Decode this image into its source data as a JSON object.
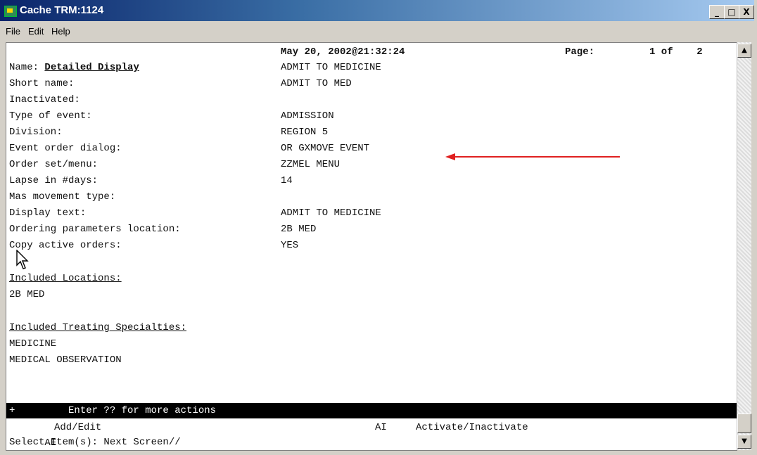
{
  "window": {
    "title": "Cache TRM:1124",
    "minimize": "_",
    "maximize": "□",
    "close": "X"
  },
  "menu": [
    "File",
    "Edit",
    "Help"
  ],
  "header": {
    "left": "Detailed Display",
    "middle": "May 20, 2002@21:32:24",
    "page_label": "Page:",
    "page": "1 of    2"
  },
  "fields": [
    {
      "label": "Name:",
      "value": "ADMIT TO MEDICINE"
    },
    {
      "label": "Short name:",
      "value": "ADMIT TO MED"
    },
    {
      "label": "Inactivated:",
      "value": ""
    },
    {
      "label": "Type of event:",
      "value": "ADMISSION"
    },
    {
      "label": "Division:",
      "value": "REGION 5"
    },
    {
      "label": "Event order dialog:",
      "value": "OR GXMOVE EVENT"
    },
    {
      "label": "Order set/menu:",
      "value": "ZZMEL MENU"
    },
    {
      "label": "Lapse in #days:",
      "value": "14"
    },
    {
      "label": "Mas movement type:",
      "value": ""
    },
    {
      "label": "Display text:",
      "value": "ADMIT TO MEDICINE"
    },
    {
      "label": "Ordering parameters location:",
      "value": "2B MED"
    },
    {
      "label": "Copy active orders:",
      "value": "YES"
    }
  ],
  "sections": {
    "locations": {
      "title": "Included Locations:",
      "items": [
        "2B MED"
      ]
    },
    "specialties": {
      "title": "Included Treating Specialties:",
      "items": [
        "MEDICINE",
        "MEDICAL OBSERVATION"
      ]
    }
  },
  "actionbar": "+         Enter ?? for more actions",
  "actions": [
    {
      "code": "AE",
      "label": "Add/Edit"
    },
    {
      "code": "AI",
      "label": "Activate/Inactivate"
    }
  ],
  "prompt": "Select Item(s): Next Screen//",
  "colors": {
    "annotation_arrow": "#e02020",
    "titlebar": "#0a246a"
  }
}
